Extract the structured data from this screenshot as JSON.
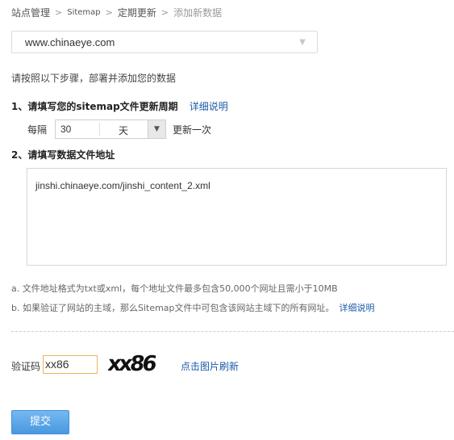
{
  "breadcrumb": {
    "items": [
      "站点管理",
      "Sitemap",
      "定期更新",
      "添加新数据"
    ]
  },
  "site_select": {
    "value": "www.chinaeye.com"
  },
  "intro": "请按照以下步骤，部署并添加您的数据",
  "step1": {
    "title": "1、请填写您的sitemap文件更新周期",
    "link": "详细说明",
    "every_label": "每隔",
    "interval_value": "30",
    "interval_unit": "天",
    "after_label": "更新一次"
  },
  "step2": {
    "title": "2、请填写数据文件地址",
    "url_value": "jinshi.chinaeye.com/jinshi_content_2.xml"
  },
  "notes": {
    "a": "a. 文件地址格式为txt或xml，每个地址文件最多包含50,000个网址且需小于10MB",
    "b": "b. 如果验证了网站的主域，那么Sitemap文件中可包含该网站主域下的所有网址。",
    "b_link": "详细说明"
  },
  "captcha": {
    "label": "验证码",
    "input_value": "xx86",
    "image_text": "xx86",
    "refresh_link": "点击图片刷新"
  },
  "submit_label": "提交"
}
